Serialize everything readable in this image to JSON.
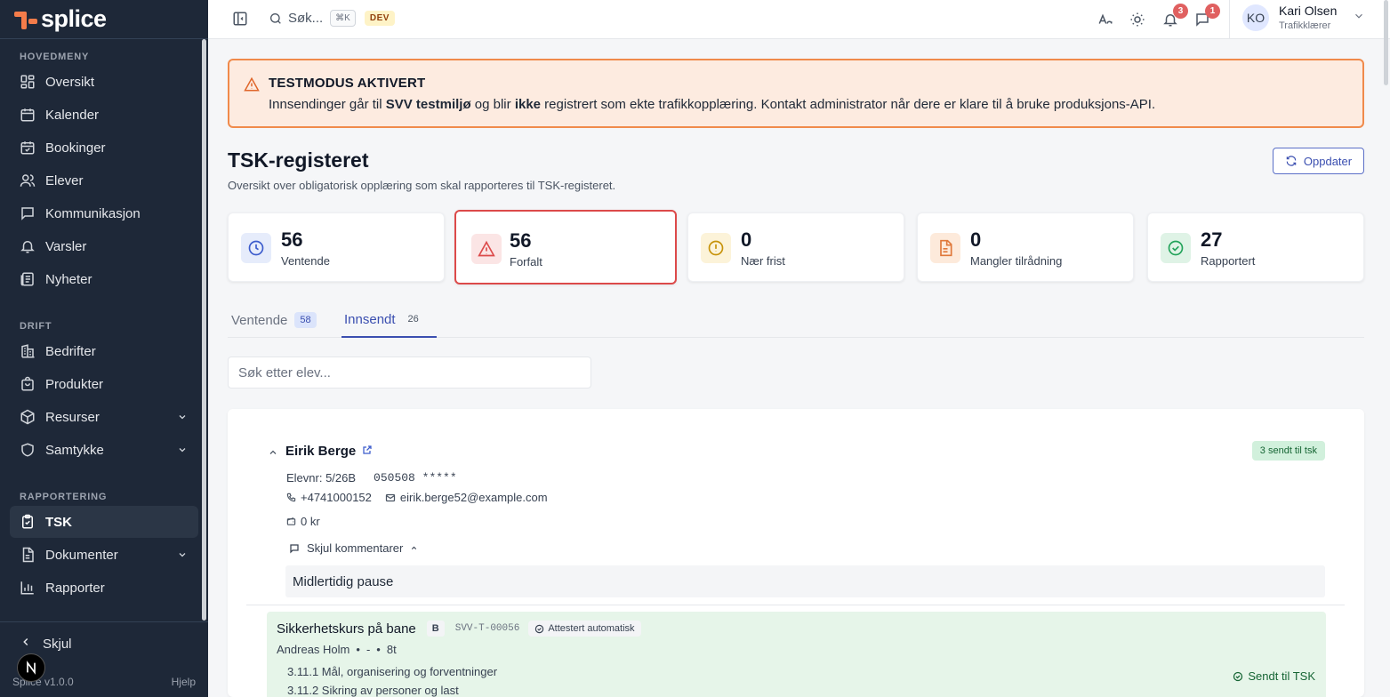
{
  "app": {
    "name": "splice",
    "version": "Splice v1.0.0",
    "help": "Hjelp",
    "hide": "Skjul"
  },
  "sidebar": {
    "sections": [
      "HOVEDMENY",
      "DRIFT",
      "RAPPORTERING"
    ],
    "items": [
      {
        "label": "Oversikt",
        "icon": "home-icon"
      },
      {
        "label": "Kalender",
        "icon": "calendar-icon"
      },
      {
        "label": "Bookinger",
        "icon": "calendar-check-icon"
      },
      {
        "label": "Elever",
        "icon": "users-icon"
      },
      {
        "label": "Kommunikasjon",
        "icon": "message-icon"
      },
      {
        "label": "Varsler",
        "icon": "bell-icon"
      },
      {
        "label": "Nyheter",
        "icon": "newspaper-icon"
      },
      {
        "label": "Bedrifter",
        "icon": "building-icon"
      },
      {
        "label": "Produkter",
        "icon": "shopping-bag-icon"
      },
      {
        "label": "Resurser",
        "icon": "box-icon"
      },
      {
        "label": "Samtykke",
        "icon": "shield-icon"
      },
      {
        "label": "TSK",
        "icon": "clipboard-check-icon"
      },
      {
        "label": "Dokumenter",
        "icon": "file-icon"
      },
      {
        "label": "Rapporter",
        "icon": "bar-chart-icon"
      }
    ]
  },
  "topbar": {
    "search_label": "Søk...",
    "shortcut": "⌘K",
    "env_badge": "DEV",
    "notifications_count": "3",
    "messages_count": "1",
    "user": {
      "initials": "KO",
      "name": "Kari Olsen",
      "role": "Trafikklærer"
    }
  },
  "alert": {
    "title": "TESTMODUS AKTIVERT",
    "text_parts": [
      "Innsendinger går til ",
      "SVV testmiljø",
      " og blir ",
      "ikke",
      " registrert som ekte trafikkopplæring. Kontakt administrator når dere er klare til å bruke produksjons-API."
    ]
  },
  "page": {
    "title": "TSK-registeret",
    "subtitle": "Oversikt over obligatorisk opplæring som skal rapporteres til TSK-registeret.",
    "refresh_label": "Oppdater"
  },
  "stats": [
    {
      "value": "56",
      "label": "Ventende",
      "color": "#3b5bcc"
    },
    {
      "value": "56",
      "label": "Forfalt",
      "color": "#dc4a4a"
    },
    {
      "value": "0",
      "label": "Nær frist",
      "color": "#d4a017"
    },
    {
      "value": "0",
      "label": "Mangler tilrådning",
      "color": "#e0783a"
    },
    {
      "value": "27",
      "label": "Rapportert",
      "color": "#22a35a"
    }
  ],
  "tabs": [
    {
      "label": "Ventende",
      "count": "58"
    },
    {
      "label": "Innsendt",
      "count": "26"
    }
  ],
  "search": {
    "placeholder": "Søk etter elev..."
  },
  "student": {
    "name": "Eirik Berge",
    "badge": "3 sendt til tsk",
    "elevnr": "Elevnr: 5/26B",
    "ssn": "050508 *****",
    "phone": "+4741000152",
    "email": "eirik.berge52@example.com",
    "balance": "0 kr",
    "comments_toggle": "Skjul kommentarer",
    "comment": "Midlertidig pause",
    "course": {
      "title": "Sikkerhetskurs på bane",
      "class": "B",
      "code": "SVV-T-00056",
      "attest": "Attestert automatisk",
      "teacher": "Andreas Holm",
      "dash": "-",
      "hours": "8t",
      "lines": [
        "3.11.1 Mål, organisering og forventninger",
        "3.11.2 Sikring av personer og last"
      ],
      "status": "Sendt til TSK"
    }
  }
}
